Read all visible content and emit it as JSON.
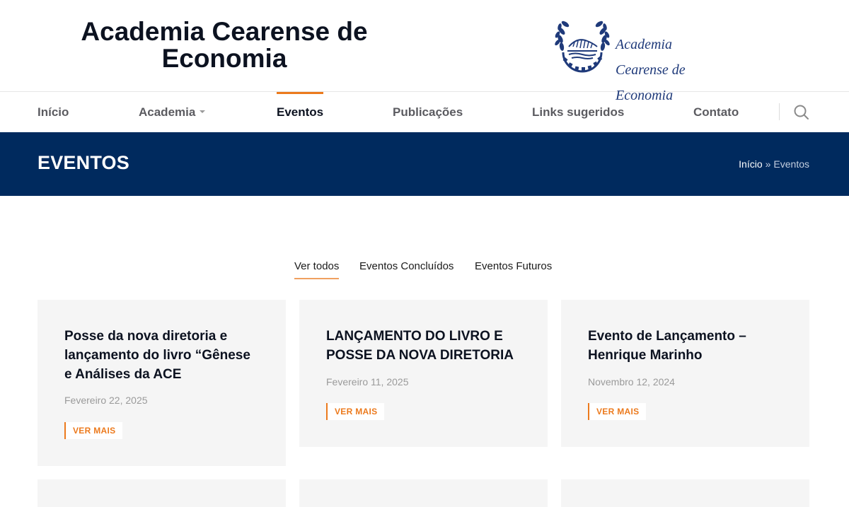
{
  "header": {
    "site_title_line1": "Academia Cearense de",
    "site_title_line2": "Economia",
    "logo_text_line1": "Academia",
    "logo_text_line2": "Cearense de",
    "logo_text_line3": "Economia",
    "logo_icon": "laurel-gear-emblem-icon"
  },
  "nav": {
    "items": [
      {
        "label": "Início"
      },
      {
        "label": "Academia",
        "has_dropdown": true
      },
      {
        "label": "Eventos",
        "active": true
      },
      {
        "label": "Publicações"
      },
      {
        "label": "Links sugeridos"
      },
      {
        "label": "Contato"
      }
    ],
    "search_icon": "search-icon"
  },
  "titlebar": {
    "title": "EVENTOS",
    "breadcrumb_home": "Início",
    "breadcrumb_sep": "»",
    "breadcrumb_current": "Eventos"
  },
  "filters": {
    "tabs": [
      {
        "label": "Ver todos",
        "active": true
      },
      {
        "label": "Eventos Concluídos"
      },
      {
        "label": "Eventos Futuros"
      }
    ]
  },
  "events": [
    {
      "title": "Posse da nova diretoria e lançamento do livro “Gênese e Análises da ACE",
      "date": "Fevereiro 22, 2025",
      "button": "VER MAIS"
    },
    {
      "title": "LANÇAMENTO DO LIVRO E POSSE DA NOVA DIRETORIA",
      "date": "Fevereiro 11, 2025",
      "button": "VER MAIS"
    },
    {
      "title": "Evento de Lançamento – Henrique Marinho",
      "date": "Novembro 12, 2024",
      "button": "VER MAIS"
    }
  ],
  "colors": {
    "accent": "#ec7a1d",
    "titlebar_bg": "#002a5e",
    "card_bg": "#f5f5f5",
    "logo_blue": "#1f3a7a"
  }
}
